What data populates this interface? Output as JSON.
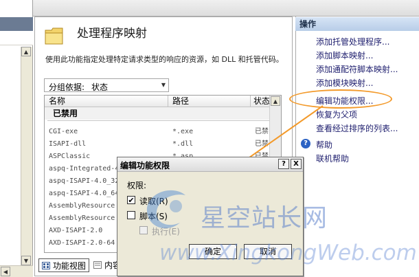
{
  "feature": {
    "title": "处理程序映射",
    "description": "使用此功能指定处理特定请求类型的响应的资源，如 DLL 和托管代码。"
  },
  "groupby": {
    "label": "分组依据:",
    "value": "状态"
  },
  "grid": {
    "columns": [
      "名称",
      "路径",
      "状态"
    ],
    "section": "已禁用",
    "rows": [
      {
        "name": "CGI-exe",
        "path": "*.exe",
        "state": "已禁"
      },
      {
        "name": "ISAPI-dll",
        "path": "*.dll",
        "state": "已禁"
      },
      {
        "name": "ASPClassic",
        "path": "*.asp",
        "state": "已禁"
      },
      {
        "name": "aspq-Integrated-4",
        "path": "",
        "state": ""
      },
      {
        "name": "aspq-ISAPI-4.0_32",
        "path": "",
        "state": ""
      },
      {
        "name": "aspq-ISAPI-4.0_64",
        "path": "",
        "state": ""
      },
      {
        "name": "AssemblyResource",
        "path": "",
        "state": ""
      },
      {
        "name": "AssemblyResource",
        "path": "",
        "state": ""
      },
      {
        "name": "AXD-ISAPI-2.0",
        "path": "",
        "state": ""
      },
      {
        "name": "AXD-ISAPI-2.0-64",
        "path": "",
        "state": ""
      }
    ]
  },
  "view_tabs": {
    "features": "功能视图",
    "content": "内容视图"
  },
  "actions": {
    "header": "操作",
    "items": [
      "添加托管处理程序...",
      "添加脚本映射...",
      "添加通配符脚本映射...",
      "添加模块映射...",
      "编辑功能权限...",
      "恢复为父项",
      "查看经过排序的列表..."
    ],
    "help": "帮助",
    "online_help": "联机帮助"
  },
  "dialog": {
    "title": "编辑功能权限",
    "help_btn": "?",
    "close_btn": "X",
    "permissions_label": "权限:",
    "read": "读取(R)",
    "read_checked": true,
    "script": "脚本(S)",
    "script_checked": false,
    "execute": "执行(E)",
    "execute_checked": false,
    "ok": "确定",
    "cancel": "取消"
  },
  "watermark": {
    "site_cn": "星空站长网",
    "site_url": "www.XingkongWeb.com"
  },
  "colors": {
    "annotation": "#f39a2b",
    "action_link": "#1e1e6e",
    "dialog_bg": "#ece9d8"
  },
  "icons": [
    "folder-icon",
    "help-circle-icon",
    "features-view-icon",
    "content-view-icon",
    "dropdown-arrow-icon"
  ]
}
